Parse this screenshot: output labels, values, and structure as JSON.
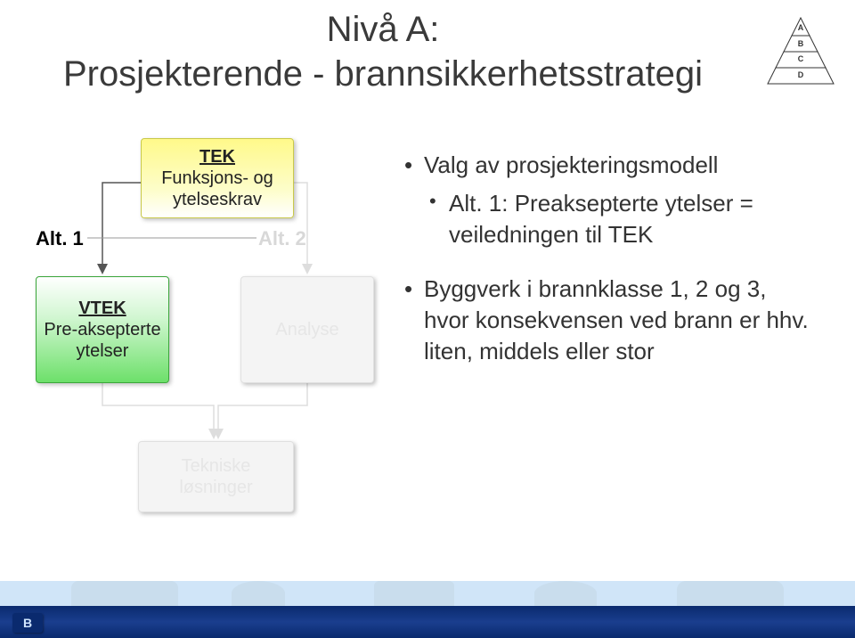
{
  "title_line1": "Nivå A:",
  "title_line2": "Prosjekterende - brannsikkerhetsstrategi",
  "pyramid": {
    "A": "A",
    "B": "B",
    "C": "C",
    "D": "D"
  },
  "diagram": {
    "tek_line1": "TEK",
    "tek_line2": "Funksjons- og ytelseskrav",
    "alt1": "Alt. 1",
    "alt2": "Alt. 2",
    "vtek_line1": "VTEK",
    "vtek_line2": "Pre-aksepterte ytelser",
    "analyse": "Analyse",
    "teknisk": "Tekniske løsninger"
  },
  "bullets": {
    "b1": "Valg av prosjekteringsmodell",
    "b1a": "Alt. 1: Preaksepterte ytelser = veiledningen til TEK",
    "b2": "Byggverk i brannklasse 1, 2 og 3, hvor konsekvensen ved brann er hhv. liten, middels eller stor"
  },
  "logo": "B"
}
